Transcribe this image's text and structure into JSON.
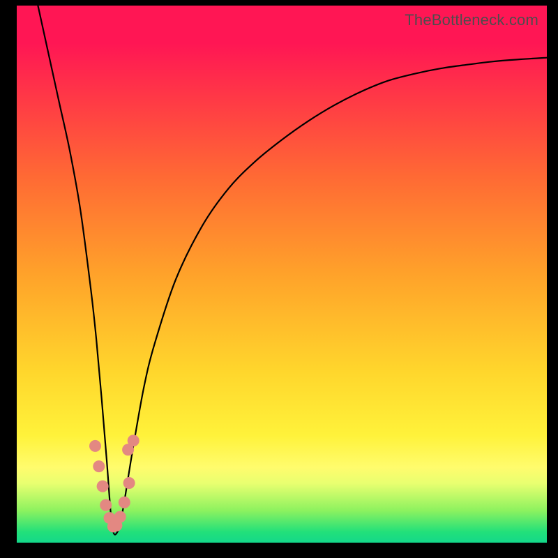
{
  "watermark": "TheBottleneck.com",
  "chart_data": {
    "type": "line",
    "title": "",
    "xlabel": "",
    "ylabel": "",
    "xlim": [
      0,
      100
    ],
    "ylim": [
      0,
      100
    ],
    "notch_x": 18,
    "series": [
      {
        "name": "curve",
        "x": [
          4,
          6,
          8,
          10,
          12,
          14,
          15,
          16,
          17,
          18,
          19,
          20,
          21,
          22,
          24,
          26,
          30,
          35,
          40,
          45,
          50,
          55,
          60,
          65,
          70,
          75,
          80,
          85,
          90,
          95,
          100
        ],
        "values": [
          100,
          91,
          82,
          73,
          62,
          47,
          38,
          27,
          15,
          3,
          2,
          6,
          12,
          18,
          29,
          37,
          49,
          59,
          66,
          71,
          75,
          78.5,
          81.5,
          84,
          86,
          87.3,
          88.3,
          89,
          89.6,
          90,
          90.3
        ]
      }
    ],
    "dots": {
      "name": "markers",
      "x": [
        14.8,
        15.5,
        16.2,
        16.8,
        17.5,
        18.2,
        18.8,
        19.5,
        20.3,
        21.2,
        21.0,
        22.0
      ],
      "values": [
        18.0,
        14.2,
        10.5,
        7.0,
        4.6,
        3.0,
        3.2,
        4.8,
        7.5,
        11.1,
        17.3,
        19.0
      ]
    },
    "colors": {
      "line": "#000000",
      "dot": "#e38882"
    }
  }
}
